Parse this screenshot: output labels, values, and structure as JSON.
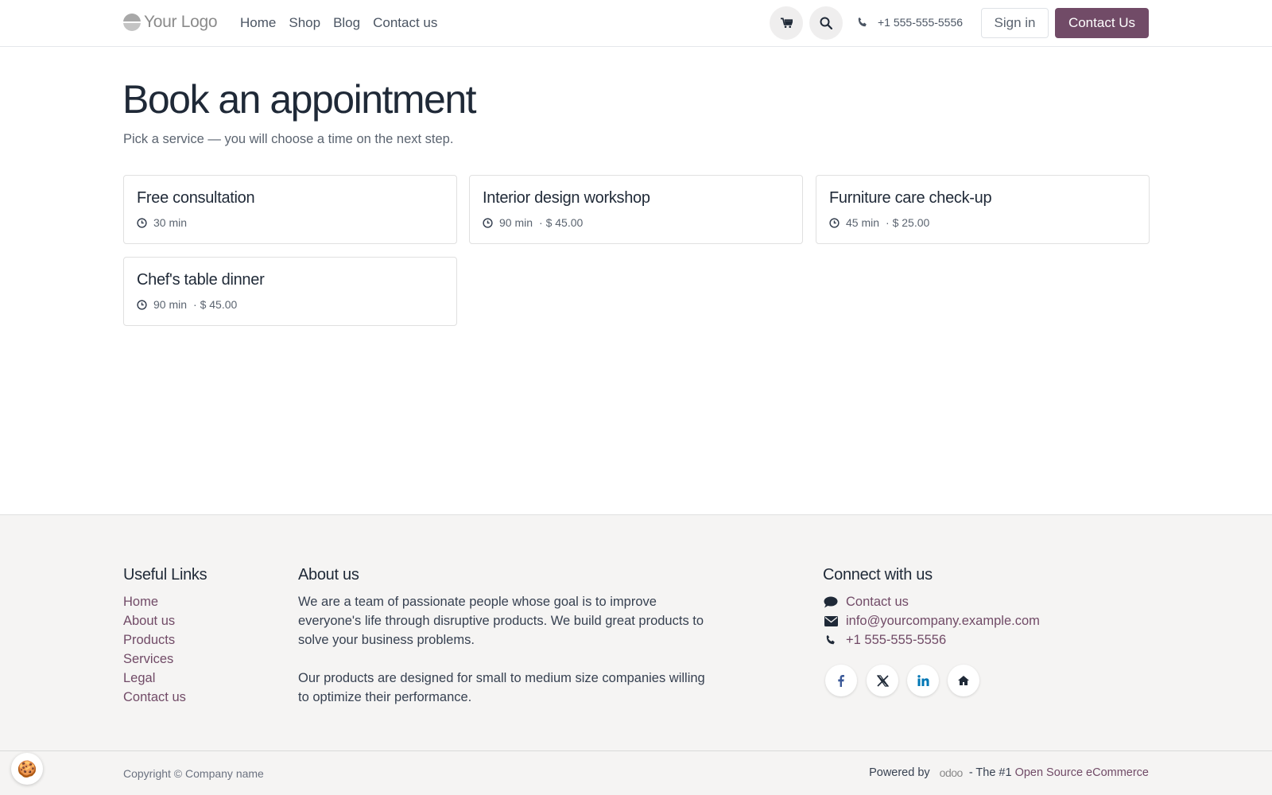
{
  "header": {
    "logo_text": "Your Logo",
    "nav": [
      "Home",
      "Shop",
      "Blog",
      "Contact us"
    ],
    "phone": "+1 555-555-5556",
    "signin_label": "Sign in",
    "contact_label": "Contact Us",
    "icons": [
      "cart-icon",
      "search-icon",
      "phone-icon"
    ]
  },
  "main": {
    "title": "Book an appointment",
    "subtitle": "Pick a service — you will choose a time on the next step.",
    "services": [
      {
        "name": "Free consultation",
        "duration": "30 min",
        "price": ""
      },
      {
        "name": "Interior design workshop",
        "duration": "90 min",
        "price": "· $ 45.00"
      },
      {
        "name": "Furniture care check-up",
        "duration": "45 min",
        "price": "· $ 25.00"
      },
      {
        "name": "Chef's table dinner",
        "duration": "90 min",
        "price": "· $ 45.00"
      }
    ]
  },
  "footer": {
    "useful_links": {
      "heading": "Useful Links",
      "items": [
        "Home",
        "About us",
        "Products",
        "Services",
        "Legal",
        "Contact us"
      ]
    },
    "about": {
      "heading": "About us",
      "paragraphs": [
        "We are a team of passionate people whose goal is to improve everyone's life through disruptive products. We build great products to solve your business problems.",
        "Our products are designed for small to medium size companies willing to optimize their performance."
      ]
    },
    "connect": {
      "heading": "Connect with us",
      "contact_label": "Contact us",
      "email": "info@yourcompany.example.com",
      "phone": "+1 555-555-5556",
      "social": [
        "facebook-icon",
        "x-twitter-icon",
        "linkedin-icon",
        "home-icon"
      ]
    },
    "copyright": "Copyright © Company name",
    "powered_prefix": "Powered by",
    "powered_brand": "odoo",
    "powered_suffix": "- The #1",
    "powered_link": "Open Source eCommerce"
  },
  "colors": {
    "brand": "#714b67",
    "footer_bg": "#f5f4f3",
    "facebook": "#3b5998",
    "linkedin": "#0077b5"
  }
}
